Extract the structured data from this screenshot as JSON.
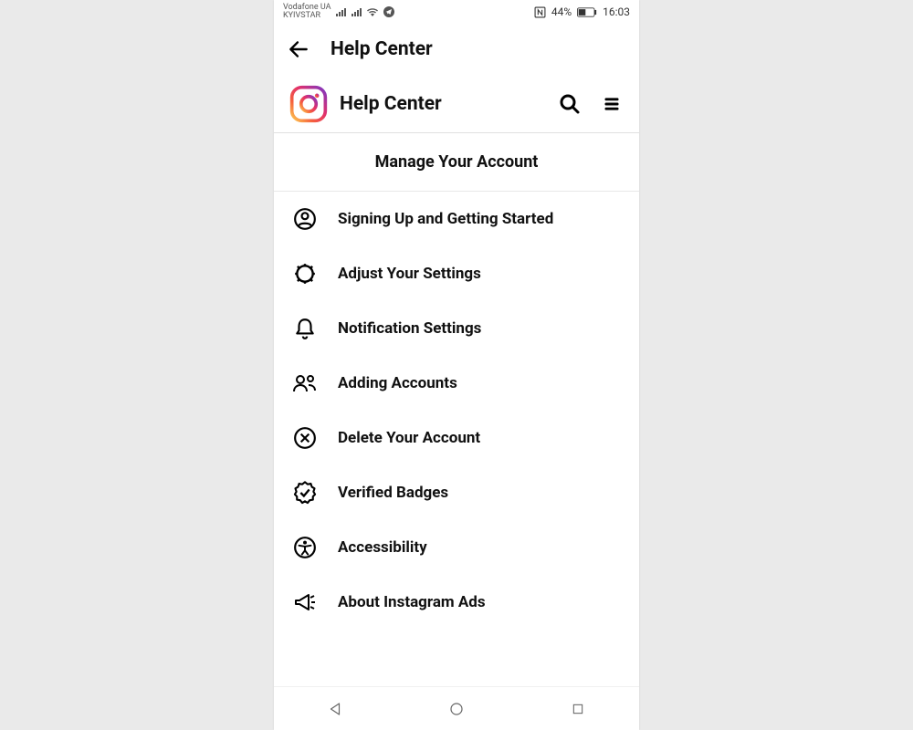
{
  "statusBar": {
    "carrier1": "Vodafone UA",
    "carrier2": "KYIVSTAR",
    "battery": "44%",
    "time": "16:03"
  },
  "appHeader": {
    "title": "Help Center"
  },
  "hcBar": {
    "title": "Help Center"
  },
  "sectionHeader": "Manage Your Account",
  "menu": {
    "items": [
      {
        "label": "Signing Up and Getting Started"
      },
      {
        "label": "Adjust Your Settings"
      },
      {
        "label": "Notification Settings"
      },
      {
        "label": "Adding Accounts"
      },
      {
        "label": "Delete Your Account"
      },
      {
        "label": "Verified Badges"
      },
      {
        "label": "Accessibility"
      },
      {
        "label": "About Instagram Ads"
      }
    ]
  }
}
